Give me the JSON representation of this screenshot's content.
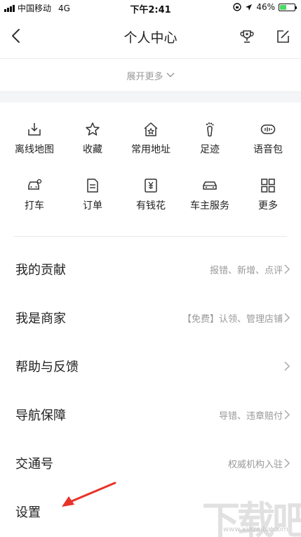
{
  "status_bar": {
    "carrier": "中国移动",
    "network": "4G",
    "time": "下午2:41",
    "battery_percent": "46%",
    "battery_level": 0.46,
    "battery_color": "#4cd964"
  },
  "header": {
    "title": "个人中心",
    "back_icon": "chevron-left-icon",
    "right_icons": [
      "trophy-icon",
      "edit-icon"
    ]
  },
  "expand": {
    "label": "展开更多"
  },
  "quick_grid": {
    "row1": [
      {
        "label": "离线地图",
        "icon": "offline-map-icon"
      },
      {
        "label": "收藏",
        "icon": "star-icon"
      },
      {
        "label": "常用地址",
        "icon": "home-star-icon"
      },
      {
        "label": "足迹",
        "icon": "footprint-icon"
      },
      {
        "label": "语音包",
        "icon": "voice-pack-icon"
      }
    ],
    "row2": [
      {
        "label": "打车",
        "icon": "taxi-icon"
      },
      {
        "label": "订单",
        "icon": "order-icon"
      },
      {
        "label": "有钱花",
        "icon": "money-icon"
      },
      {
        "label": "车主服务",
        "icon": "car-owner-icon"
      },
      {
        "label": "更多",
        "icon": "grid-more-icon"
      }
    ]
  },
  "list": [
    {
      "title": "我的贡献",
      "subtitle": "报错、新增、点评"
    },
    {
      "title": "我是商家",
      "subtitle": "【免费】认领、管理店铺"
    },
    {
      "title": "帮助与反馈",
      "subtitle": ""
    },
    {
      "title": "导航保障",
      "subtitle": "导错、违章赔付"
    },
    {
      "title": "交通号",
      "subtitle": "权威机构入驻"
    },
    {
      "title": "设置",
      "subtitle": ""
    }
  ],
  "colors": {
    "annotation_arrow": "#e8332a",
    "text_secondary": "#999999"
  },
  "watermark": {
    "text": "下载吧",
    "sub": "www.xiazaiba.com"
  }
}
